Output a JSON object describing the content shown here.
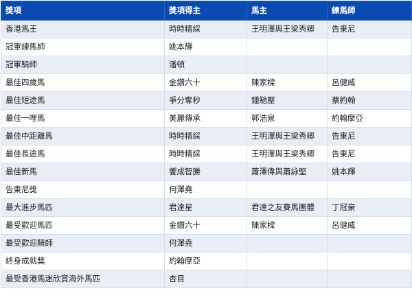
{
  "table": {
    "headers": [
      "獎項",
      "獎項得主",
      "馬主",
      "練馬師"
    ],
    "rows": [
      [
        "香港馬王",
        "時時精綵",
        "王明澤與王梁秀卿",
        "告東尼"
      ],
      [
        "冠軍練馬師",
        "姚本輝",
        "",
        ""
      ],
      [
        "冠軍騎師",
        "潘頓",
        "",
        ""
      ],
      [
        "最佳四歲馬",
        "金鑽六十",
        "陳家樑",
        "呂健威"
      ],
      [
        "最佳短途馬",
        "爭分奪秒",
        "鍾馳壓",
        "蔡約翰"
      ],
      [
        "最佳一哩馬",
        "美麗傳承",
        "郭浩泉",
        "約翰摩亞"
      ],
      [
        "最佳中距離馬",
        "時時精綵",
        "王明澤與王梁秀卿",
        "告東尼"
      ],
      [
        "最佳長途馬",
        "時時精綵",
        "王明澤與王梁秀卿",
        "告東尼"
      ],
      [
        "最佳新馬",
        "饗成智勝",
        "蕭澤偉與蕭詠堅",
        "姚本輝"
      ],
      [
        "告東尼獎",
        "何澤堯",
        "",
        ""
      ],
      [
        "最大進步馬匹",
        "君達星",
        "君達之友賽馬團體",
        "丁冠豪"
      ],
      [
        "最受歡迎馬匹",
        "金鑽六十",
        "陳家樑",
        "呂健威"
      ],
      [
        "最受歡迎騎師",
        "何澤堯",
        "",
        ""
      ],
      [
        "終身成就獎",
        "約翰摩亞",
        "",
        ""
      ],
      [
        "最受香港馬迷欣賞海外馬匹",
        "杏目",
        "",
        ""
      ]
    ]
  }
}
